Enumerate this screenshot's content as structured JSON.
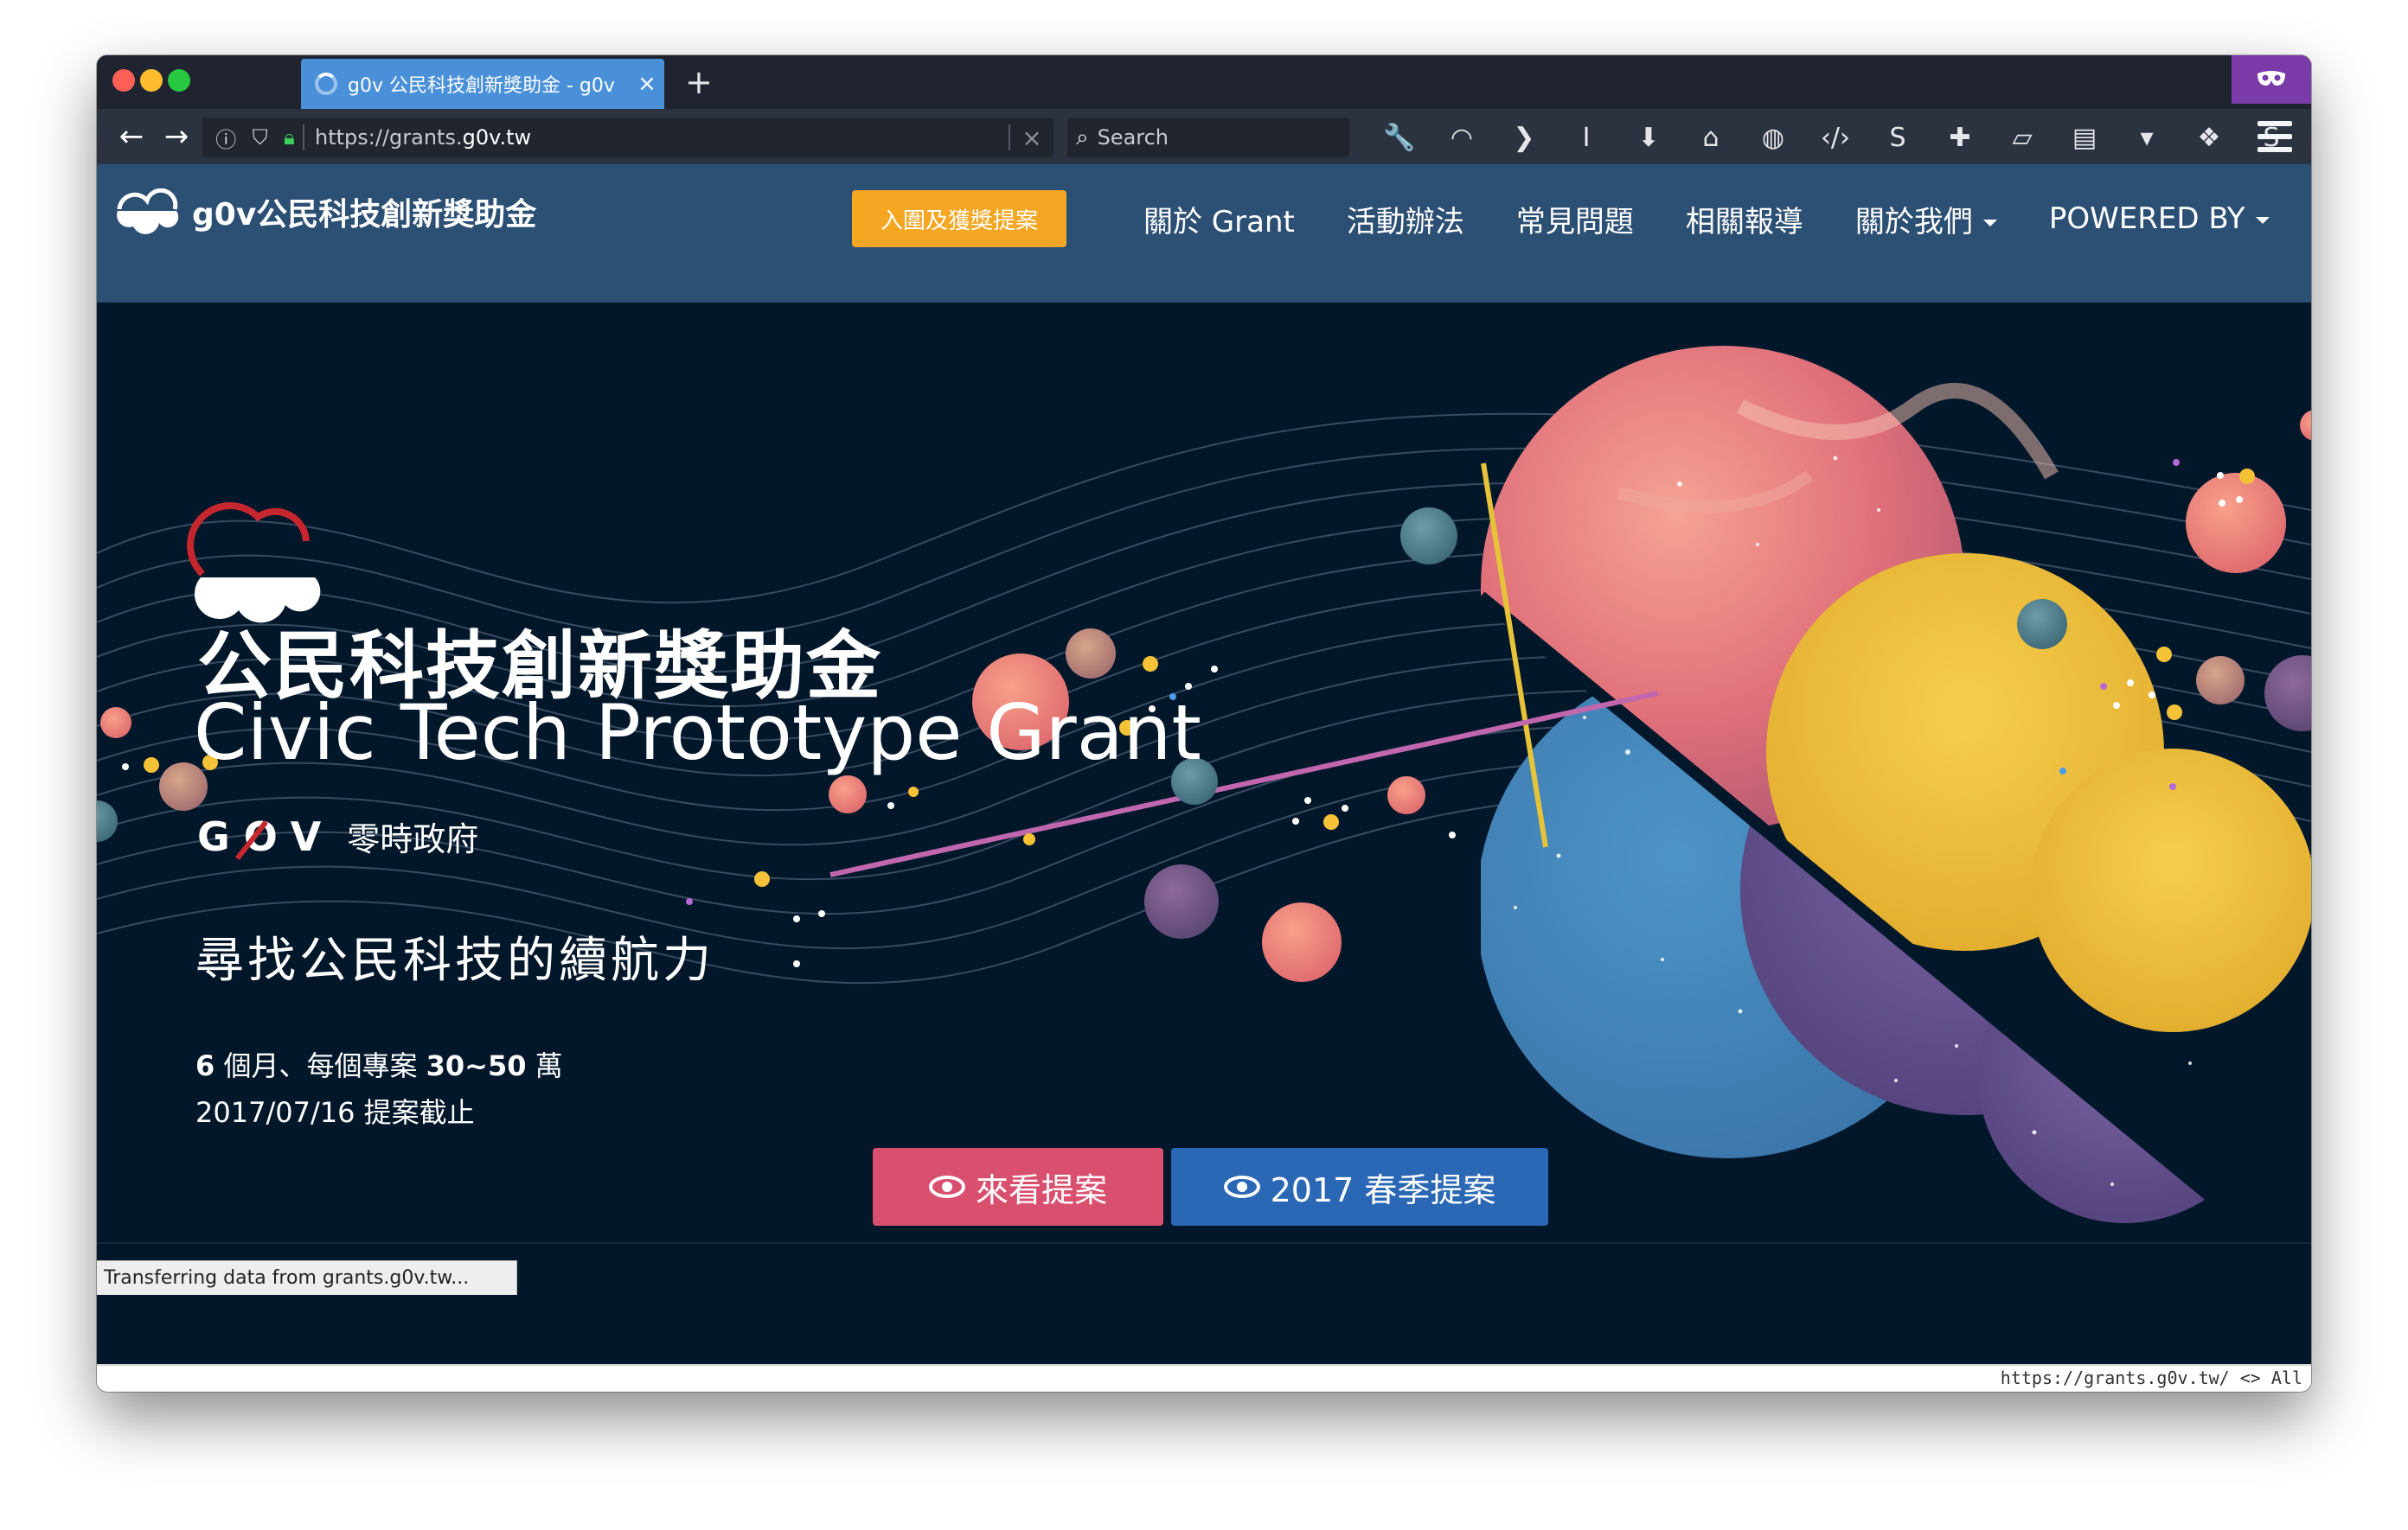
{
  "browser": {
    "tab": {
      "title": "g0v 公民科技創新獎助金 - g0v",
      "close": "×"
    },
    "new_tab": "+",
    "url_host_prefix": "https://grants.",
    "url_host_main": "g0v.tw",
    "url_clear": "×",
    "search_placeholder": "Search",
    "icons": [
      "wrench-icon",
      "rss-icon",
      "pocket-icon",
      "readability-icon",
      "download-icon",
      "home-icon",
      "globe-icon",
      "code-icon",
      "s-extension-icon",
      "medic-extension-icon",
      "notepad-icon",
      "page-icon",
      "dropdown-icon",
      "shield-extension-icon",
      "s-blue-extension-icon",
      "ublock-icon"
    ],
    "glyphs": [
      "🔧",
      "◠",
      "❯",
      "I",
      "⬇",
      "⌂",
      "◍",
      "‹/›",
      "S",
      "✚",
      "▱",
      "▤",
      "▾",
      "❖",
      "S",
      "◆"
    ]
  },
  "site": {
    "brand": "g0v公民科技創新獎助金",
    "cta": "入圍及獲獎提案",
    "nav": [
      {
        "label": "關於 Grant",
        "dropdown": false
      },
      {
        "label": "活動辦法",
        "dropdown": false
      },
      {
        "label": "常見問題",
        "dropdown": false
      },
      {
        "label": "相關報導",
        "dropdown": false
      },
      {
        "label": "關於我們",
        "dropdown": true
      },
      {
        "label": "POWERED BY",
        "dropdown": true
      }
    ]
  },
  "hero": {
    "title_zh": "公民科技創新獎助金",
    "title_en": "Civic Tech Prototype Grant",
    "gov_mark": "GOV",
    "gov_zh": "零時政府",
    "slogan": "尋找公民科技的續航力",
    "info_line1": {
      "months": "6",
      "t1": " 個月、每個專案 ",
      "amount": "30~50",
      "t2": " 萬"
    },
    "info_line2": "2017/07/16 提案截止",
    "btn_view": "來看提案",
    "btn_spring": "2017 春季提案"
  },
  "status": {
    "transfer": "Transferring data from grants.g0v.tw...",
    "bottom_right": "https://grants.g0v.tw/ <> All"
  },
  "colors": {
    "hero_bg": "#03172b",
    "header_bg": "#2c4f74",
    "cta": "#f5a623",
    "btn_view": "#d9506f",
    "btn_spring": "#2a67b4",
    "logo_red": "#c6262e"
  }
}
